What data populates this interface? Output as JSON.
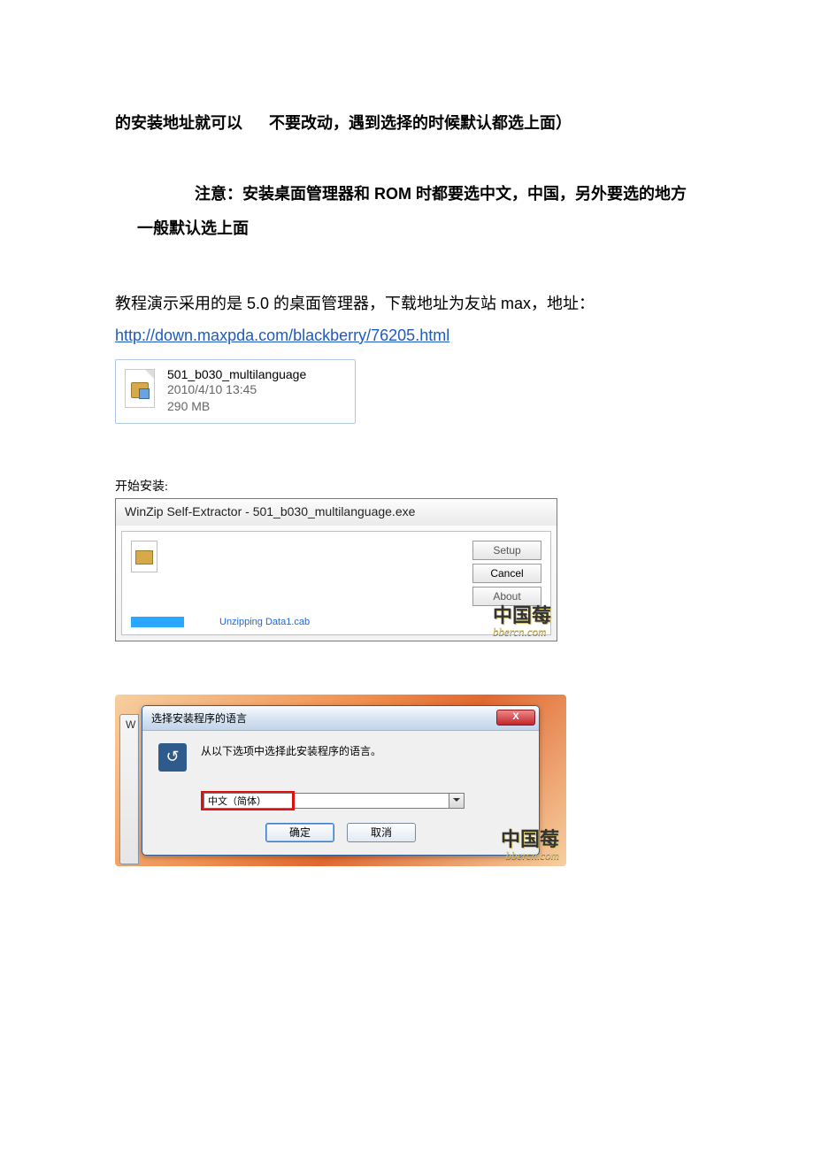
{
  "para1_seg1": "的安装地址就可以",
  "para1_seg2": "不要改动，遇到选择的时候默认都选上面）",
  "para2_seg1": "注意：安装桌面管理器和 ROM 时都要选中文，中国，另外要选的地方",
  "para2_seg2": "一般默认选上面",
  "para3": "教程演示采用的是 5.0 的桌面管理器，下载地址为友站 max，地址：",
  "download_url": "http://down.maxpda.com/blackberry/76205.html",
  "file": {
    "name": "501_b030_multilanguage",
    "date": "2010/4/10 13:45",
    "size": "290 MB"
  },
  "caption_start_install": "开始安装:",
  "winzip": {
    "title": "WinZip Self-Extractor - 501_b030_multilanguage.exe",
    "status": "Unzipping Data1.cab",
    "buttons": {
      "setup": "Setup",
      "cancel": "Cancel",
      "about": "About"
    }
  },
  "watermark": {
    "cn": "中国莓",
    "en": "bbercn.com"
  },
  "lang_dialog": {
    "back_letter": "W",
    "title": "选择安装程序的语言",
    "instruction": "从以下选项中选择此安装程序的语言。",
    "selected": "中文（简体）",
    "ok": "确定",
    "cancel": "取消",
    "close_x": "X"
  }
}
